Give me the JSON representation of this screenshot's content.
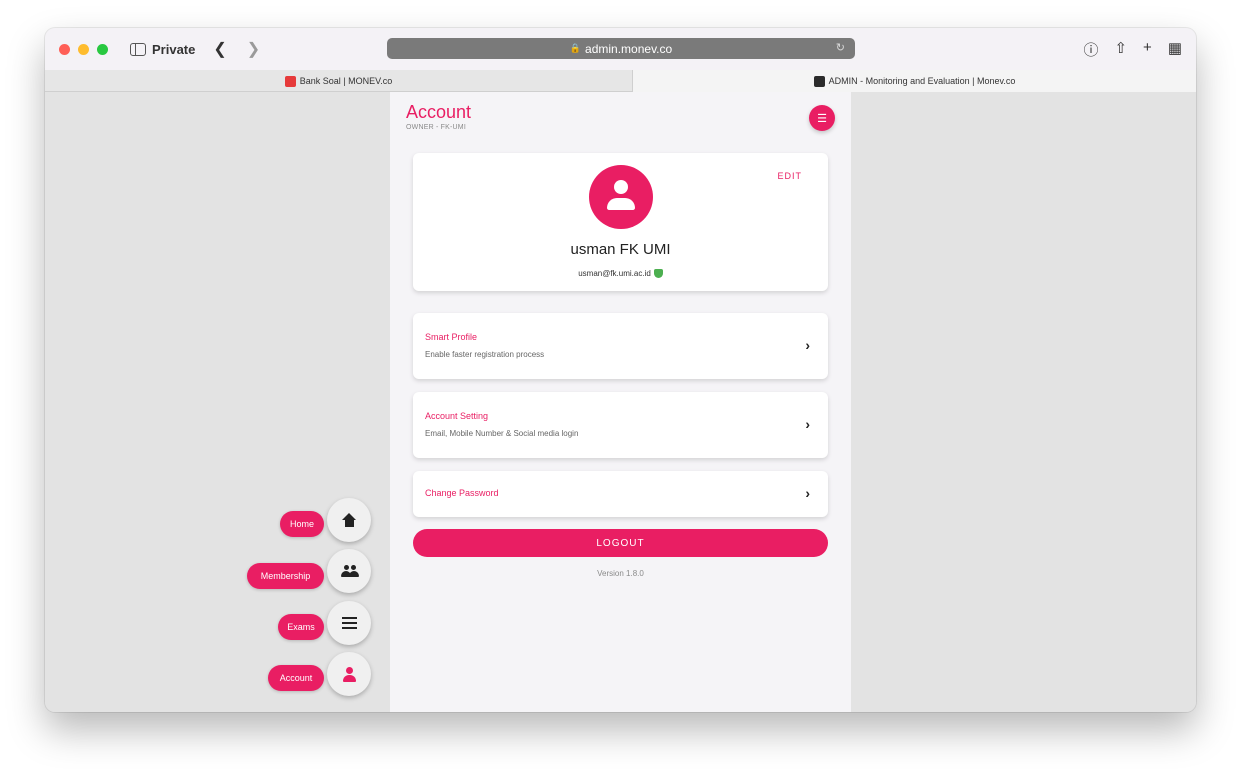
{
  "browser": {
    "private_label": "Private",
    "address": "admin.monev.co",
    "tabs": [
      {
        "title": "Bank Soal | MONEV.co"
      },
      {
        "title": "ADMIN - Monitoring and Evaluation | Monev.co"
      }
    ]
  },
  "page": {
    "title": "Account",
    "subtitle": "OWNER - FK-UMI"
  },
  "profile": {
    "edit_label": "EDIT",
    "name": "usman FK UMI",
    "email": "usman@fk.umi.ac.id"
  },
  "menu": [
    {
      "title": "Smart Profile",
      "description": "Enable faster registration process"
    },
    {
      "title": "Account Setting",
      "description": "Email, Mobile Number & Social media login"
    },
    {
      "title": "Change Password"
    }
  ],
  "logout_label": "LOGOUT",
  "version": "Version 1.8.0",
  "nav": [
    {
      "label": "Home",
      "icon": "home-icon"
    },
    {
      "label": "Membership",
      "icon": "users-icon"
    },
    {
      "label": "Exams",
      "icon": "list-icon"
    },
    {
      "label": "Account",
      "icon": "person-icon",
      "active": true
    }
  ],
  "colors": {
    "accent": "#e91e63",
    "background": "#e3e3e3",
    "panel": "#f5f4f7"
  }
}
